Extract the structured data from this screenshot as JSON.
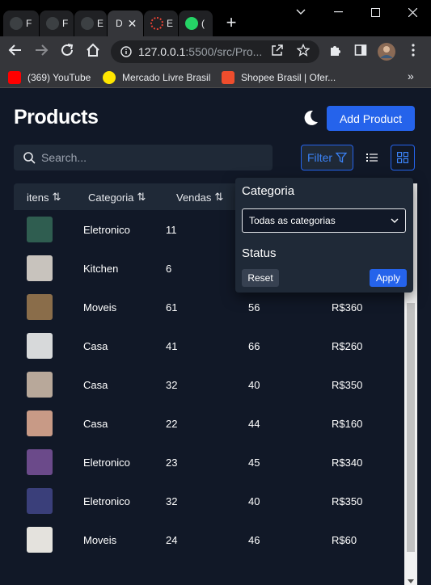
{
  "browser": {
    "tabs": [
      {
        "label": "F",
        "active": false
      },
      {
        "label": "F",
        "active": false
      },
      {
        "label": "E",
        "active": false
      },
      {
        "label": "D",
        "active": true
      },
      {
        "label": "E",
        "active": false
      },
      {
        "label": "(",
        "active": false
      }
    ],
    "address": {
      "host": "127.0.0.1",
      "rest": ":5500/src/Pro..."
    },
    "bookmarks": [
      {
        "label": "(369) YouTube",
        "color": "#ff0000"
      },
      {
        "label": "Mercado Livre Brasil",
        "color": "#ffe600"
      },
      {
        "label": "Shopee Brasil | Ofer...",
        "color": "#ee4d2d"
      }
    ],
    "bookmarks_more": "»"
  },
  "page": {
    "title": "Products",
    "add_button": "Add Product",
    "search_placeholder": "Search...",
    "filter_button": "Filter",
    "table": {
      "headers": [
        "itens",
        "Categoria",
        "Vendas"
      ],
      "rows": [
        {
          "thumb_color": "#2f5d50",
          "categoria": "Eletronico",
          "vendas": "11",
          "col4": "",
          "preco": ""
        },
        {
          "thumb_color": "#c8c3bd",
          "categoria": "Kitchen",
          "vendas": "6",
          "col4": "",
          "preco": ""
        },
        {
          "thumb_color": "#8a6d4a",
          "categoria": "Moveis",
          "vendas": "61",
          "col4": "56",
          "preco": "R$360"
        },
        {
          "thumb_color": "#d7d9da",
          "categoria": "Casa",
          "vendas": "41",
          "col4": "66",
          "preco": "R$260"
        },
        {
          "thumb_color": "#b8a89a",
          "categoria": "Casa",
          "vendas": "32",
          "col4": "40",
          "preco": "R$350"
        },
        {
          "thumb_color": "#c89a86",
          "categoria": "Casa",
          "vendas": "22",
          "col4": "44",
          "preco": "R$160"
        },
        {
          "thumb_color": "#6b4a8a",
          "categoria": "Eletronico",
          "vendas": "23",
          "col4": "45",
          "preco": "R$340"
        },
        {
          "thumb_color": "#3a3f7a",
          "categoria": "Eletronico",
          "vendas": "32",
          "col4": "40",
          "preco": "R$350"
        },
        {
          "thumb_color": "#e4e2dd",
          "categoria": "Moveis",
          "vendas": "24",
          "col4": "46",
          "preco": "R$60"
        }
      ]
    },
    "filter_dropdown": {
      "category_label": "Categoria",
      "category_value": "Todas as categorias",
      "status_label": "Status",
      "reset": "Reset",
      "apply": "Apply"
    }
  }
}
